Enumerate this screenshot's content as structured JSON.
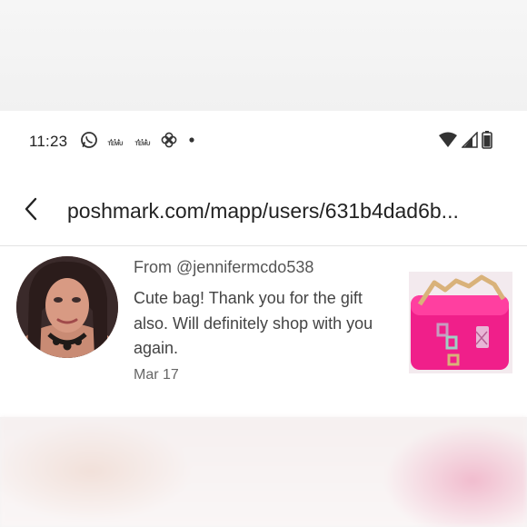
{
  "status_bar": {
    "time": "11:23",
    "left_icons": [
      "whatsapp-icon",
      "temu-icon",
      "temu-icon",
      "pinwheel-icon",
      "dot-icon"
    ],
    "temu_label": "TEMU",
    "right_icons": [
      "wifi-icon",
      "cell-signal-icon",
      "battery-icon"
    ]
  },
  "address_bar": {
    "url": "poshmark.com/mapp/users/631b4dad6b..."
  },
  "review": {
    "from": "From @jennifermcdo538",
    "comment": "Cute bag! Thank you for the gift also. Will definitely shop with you again.",
    "date": "Mar 17",
    "accent_colors": {
      "bag": "#f01f8a",
      "chain": "#d9b27a"
    }
  }
}
